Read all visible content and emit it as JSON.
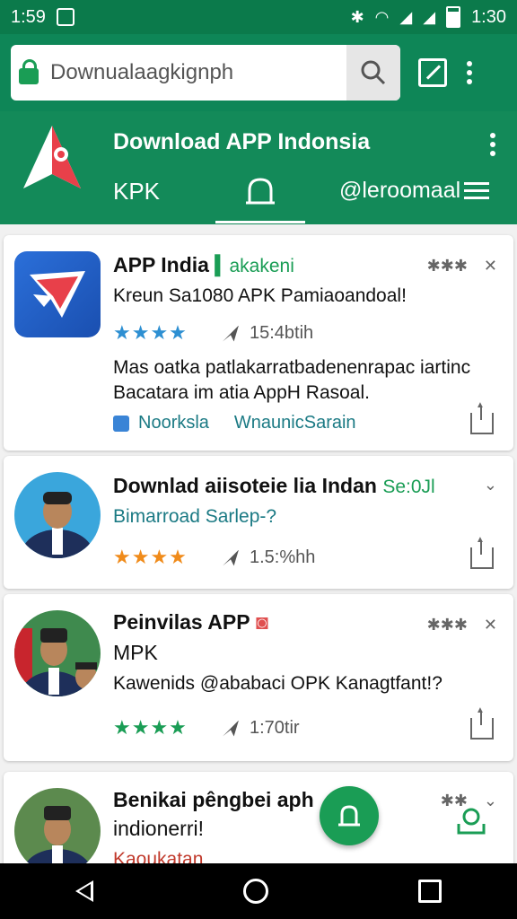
{
  "status": {
    "time_left": "1:59",
    "time_right": "1:30"
  },
  "browser": {
    "url": "Downualaagkignph"
  },
  "header": {
    "title": "Download APP Indonsia",
    "tabs": [
      {
        "label": "KPK"
      },
      {
        "label": ""
      },
      {
        "label": "@leroomaal"
      }
    ]
  },
  "cards": [
    {
      "title": "APP India",
      "tag": "akakeni",
      "subtitle": "Kreun Sa1080 APK Pamiaoandoal!",
      "stars": "★★★★",
      "meta": "15:4btih",
      "desc1": "Mas oatka patlakarratbadenenrapac iartinc",
      "desc2": "Bacatara im atia AppH Rasoal.",
      "link1": "Noorksla",
      "link2": "WnaunicSarain"
    },
    {
      "title": "Downlad aiisoteie lia Indan",
      "tag": "Se:0Jl",
      "subtitle": "Bimarroad Sarlep-?",
      "stars": "★★★★",
      "meta": "1.5:%hh"
    },
    {
      "title": "Peinvilas APP",
      "title2": "MPK",
      "subtitle": "Kawenids @ababaci OPK Kanagtfant!?",
      "stars": "★★★★",
      "meta": "1:70tir"
    },
    {
      "title": "Benikai pêngbei aph",
      "title2": "indionerri!",
      "subtitle": "Kaoukatan"
    }
  ]
}
